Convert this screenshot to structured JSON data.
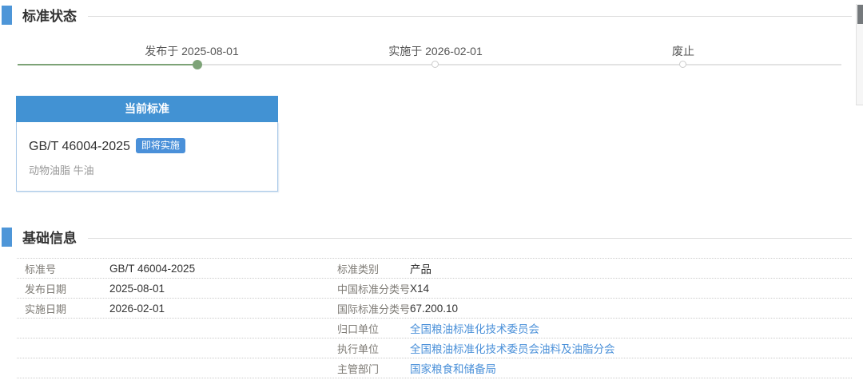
{
  "sections": {
    "status": {
      "title": "标准状态"
    },
    "basic": {
      "title": "基础信息"
    }
  },
  "timeline": {
    "stages": [
      {
        "label": "发布于 2025-08-01",
        "state": "done"
      },
      {
        "label": "实施于 2026-02-01",
        "state": "todo"
      },
      {
        "label": "废止",
        "state": "todo"
      }
    ]
  },
  "current_standard_card": {
    "header": "当前标准",
    "code": "GB/T 46004-2025",
    "badge": "即将实施",
    "name": "动物油脂 牛油"
  },
  "basic_info": {
    "rows": [
      {
        "l1": "标准号",
        "v1": "GB/T 46004-2025",
        "l2": "标准类别",
        "v2": "产品"
      },
      {
        "l1": "发布日期",
        "v1": "2025-08-01",
        "l2": "中国标准分类号",
        "v2": "X14"
      },
      {
        "l1": "实施日期",
        "v1": "2026-02-01",
        "l2": "国际标准分类号",
        "v2": "67.200.10"
      },
      {
        "l1": "",
        "v1": "",
        "l2": "归口单位",
        "v2": "全国粮油标准化技术委员会"
      },
      {
        "l1": "",
        "v1": "",
        "l2": "执行单位",
        "v2": "全国粮油标准化技术委员会油料及油脂分会"
      },
      {
        "l1": "",
        "v1": "",
        "l2": "主管部门",
        "v2": "国家粮食和储备局"
      }
    ]
  },
  "colors": {
    "accent_blue": "#4e96d8",
    "card_header_blue": "#4292d3",
    "badge_blue": "#4a90d9",
    "link_blue": "#4a90d9",
    "progress_green": "#7da377",
    "track_gray": "#e3e3e3"
  }
}
